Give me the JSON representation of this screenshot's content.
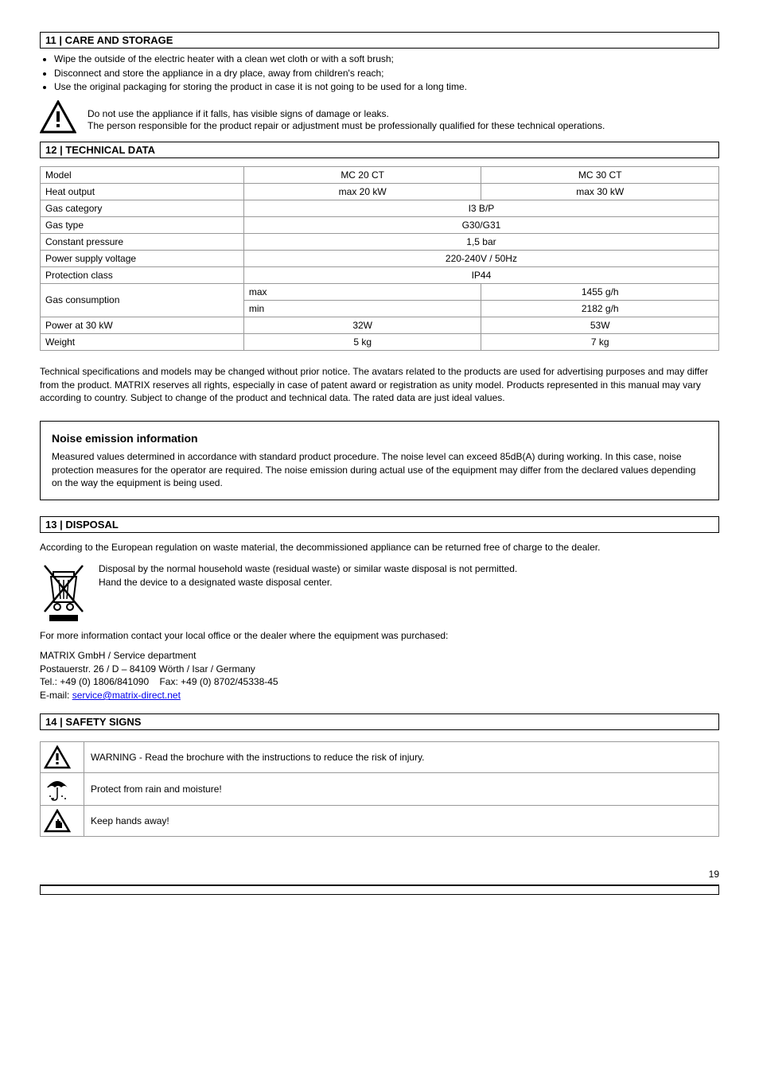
{
  "headers": {
    "care": "11 | CARE AND STORAGE",
    "technical": "12 | TECHNICAL DATA",
    "disposal": "13 | DISPOSAL",
    "safety": "14 | SAFETY SIGNS"
  },
  "care_items": [
    "Wipe the outside of the electric heater with a clean wet cloth or with a soft brush;",
    "Disconnect and store the appliance in a dry place, away from children's reach;",
    "Use the original packaging for storing the product in case it is not going to be used for a long time."
  ],
  "tech_note": {
    "p1": "Do not use the appliance if it falls, has visible signs of damage or leaks.",
    "p2": "The person responsible for the product repair or adjustment must be professionally qualified for these technical operations."
  },
  "spec": {
    "rows": {
      "model_label": "Model",
      "model_v1": "MC 20 CT",
      "model_v2": "MC 30 CT",
      "heat_label": "Heat output",
      "heat_v1": "max 20 kW",
      "heat_v2": "max 30 kW",
      "gascat_label": "Gas category",
      "gascat_v": "I3 B/P",
      "gastype_label": "Gas type",
      "gastype_v": "G30/G31",
      "press_label": "Constant pressure",
      "press_v": "1,5 bar",
      "power_label": "Power supply voltage",
      "power_v": "220-240V / 50Hz",
      "class_label": "Protection class",
      "class_v": "IP44",
      "gascons_label": "Gas consumption",
      "gascons_max": "max",
      "gascons_min": "min",
      "gascons_max_v": "1455 g/h",
      "gascons_min_v": "2182 g/h",
      "power30_label": "Power at 30 kW",
      "power30_v1": "32W",
      "power30_v2": "53W",
      "weight_label": "Weight",
      "weight_v1": "5 kg",
      "weight_v2": "7 kg"
    }
  },
  "tech_para": "Technical specifications and models may be changed without prior notice. The avatars related to the products are used for advertising purposes and may differ from the product. MATRIX reserves all rights, especially in case of patent award or registration as unity model. Products represented in this manual may vary according to country. Subject to change of the product and technical data. The rated data are just ideal values.",
  "noise": {
    "title": "Noise emission information",
    "body": "Measured values determined in accordance with standard product procedure. The noise level can exceed 85dB(A) during working. In this case, noise protection measures for the operator are required. The noise emission during actual use of the equipment may differ from the declared values depending on the way the equipment is being used."
  },
  "disposal": {
    "p1": "According to the European regulation on waste material, the decommissioned appliance can be returned free of charge to the dealer.",
    "p2": "Disposal by the normal household waste (residual waste) or similar waste disposal is not permitted.",
    "p3": "Hand the device to a designated waste disposal center."
  },
  "contact": {
    "heading": "For more information contact your local office or the dealer where the equipment was purchased:",
    "company": "MATRIX GmbH / Service department",
    "addr1": "Postauerstr. 26 / D – 84109 Wörth / Isar / Germany",
    "tel_label": "Tel.:",
    "tel": "+49 (0) 1806/841090",
    "fax_label": "Fax:",
    "fax": "+49 (0) 8702/45338-45",
    "email_label": "E-mail:",
    "email": "service@matrix-direct.net"
  },
  "safety_rows": [
    "WARNING - Read the brochure with the instructions to reduce the risk of injury.",
    "Protect from rain and moisture!",
    "Keep hands away!"
  ],
  "page_number": "19"
}
